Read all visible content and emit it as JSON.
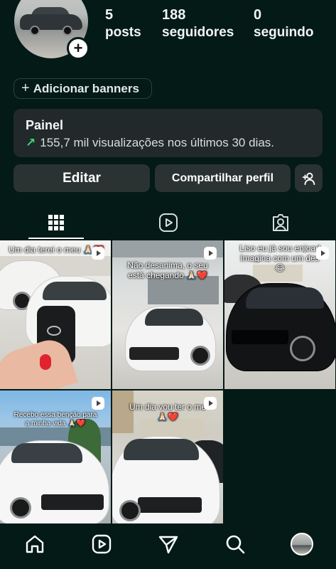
{
  "profile": {
    "stats": [
      {
        "value": "5",
        "label": "posts"
      },
      {
        "value": "188",
        "label": "seguidores"
      },
      {
        "value": "0",
        "label": "seguindo"
      }
    ],
    "add_story_icon": "plus-icon"
  },
  "banner_button": {
    "label": "Adicionar banners",
    "icon": "plus-icon"
  },
  "dashboard": {
    "title": "Painel",
    "stat_text": "155,7 mil visualizações nos últimos 30 dias.",
    "trend_color": "#3fd17a"
  },
  "actions": {
    "edit_label": "Editar",
    "share_label": "Compartilhar perfil",
    "discover_icon": "add-person-icon"
  },
  "tabs": [
    {
      "name": "grid",
      "icon": "grid-icon",
      "active": true
    },
    {
      "name": "reels",
      "icon": "reels-icon",
      "active": false
    },
    {
      "name": "tagged",
      "icon": "tagged-icon",
      "active": false
    }
  ],
  "posts": [
    {
      "caption": "Um dia terei o meu 🙏🏻❤️",
      "type": "reel"
    },
    {
      "caption_line1": "Não desanima, o seu",
      "caption_line2": "está chegando 🙏🏻❤️",
      "type": "reel"
    },
    {
      "caption_line1": "Liso eu já sou enjoad",
      "caption_line2": "Imagina com um des",
      "caption_line3": "😂",
      "type": "reel"
    },
    {
      "caption_line1": "Recebo essa benção para",
      "caption_line2": "a minha vida 🙏🏻❤️",
      "type": "reel"
    },
    {
      "caption_line1": "Um dia vou ter o me",
      "caption_line2": "🙏🏻❤️",
      "type": "reel"
    }
  ],
  "bottom_nav": [
    {
      "name": "home",
      "icon": "home-icon"
    },
    {
      "name": "reels",
      "icon": "reels-icon"
    },
    {
      "name": "direct",
      "icon": "send-icon"
    },
    {
      "name": "search",
      "icon": "search-icon"
    },
    {
      "name": "profile",
      "icon": "avatar"
    }
  ]
}
